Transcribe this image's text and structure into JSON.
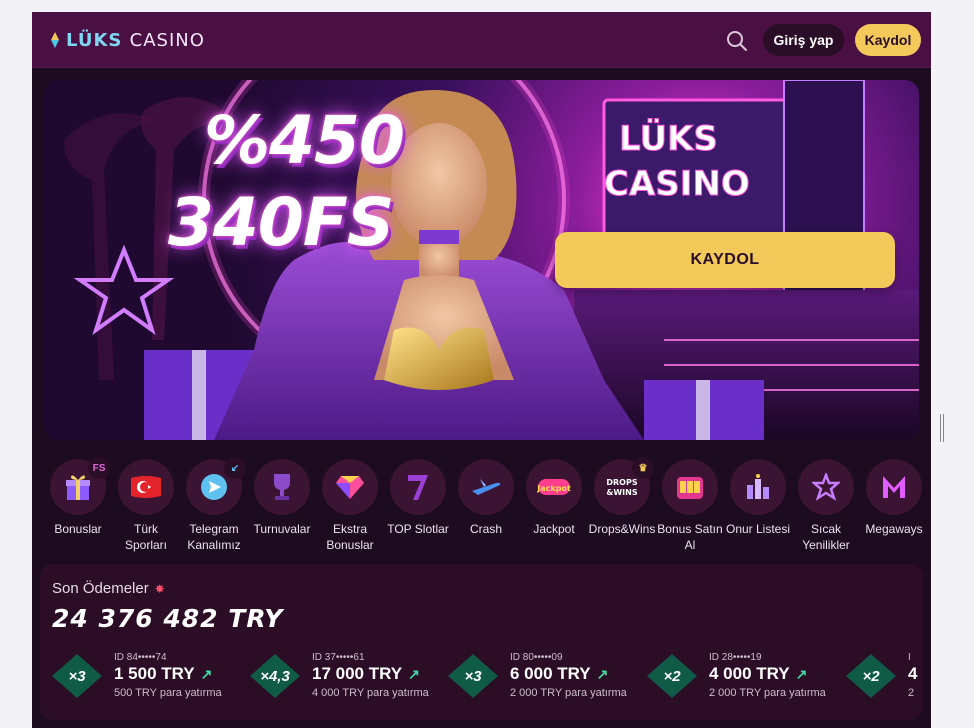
{
  "header": {
    "logo_part1": "LÜKS",
    "logo_part2": "CASINO",
    "login_label": "Giriş yap",
    "register_label": "Kaydol"
  },
  "hero": {
    "promo_line1": "%450",
    "promo_line2": "340FS",
    "cta_label": "KAYDOL",
    "sign_text_1": "LÜKS",
    "sign_text_2": "CASINO"
  },
  "categories": [
    {
      "label": "Bonuslar",
      "icon": "gift-icon",
      "badge": "FS"
    },
    {
      "label": "Türk Sporları",
      "icon": "turkish-flag-icon"
    },
    {
      "label": "Telegram Kanalımız",
      "icon": "telegram-icon",
      "badge": "arrow"
    },
    {
      "label": "Turnuvalar",
      "icon": "trophy-icon"
    },
    {
      "label": "Ekstra Bonuslar",
      "icon": "diamond-icon"
    },
    {
      "label": "TOP Slotlar",
      "icon": "lucky-seven-icon"
    },
    {
      "label": "Crash",
      "icon": "airplane-icon"
    },
    {
      "label": "Jackpot",
      "icon": "jackpot-icon"
    },
    {
      "label": "Drops&Wins",
      "icon": "drops-wins-icon",
      "badge": "crown"
    },
    {
      "label": "Bonus Satın Al",
      "icon": "slot-machine-icon"
    },
    {
      "label": "Onur Listesi",
      "icon": "leaderboard-icon"
    },
    {
      "label": "Sıcak Yenilikler",
      "icon": "star-icon"
    },
    {
      "label": "Megaways",
      "icon": "megaways-icon"
    }
  ],
  "payments": {
    "title": "Son Ödemeler",
    "total": "24 376 482 TRY",
    "items": [
      {
        "multiplier": "×3",
        "id": "ID 84•••••74",
        "amount": "1 500 TRY",
        "sub": "500 TRY para yatırma"
      },
      {
        "multiplier": "×4,3",
        "id": "ID 37•••••61",
        "amount": "17 000 TRY",
        "sub": "4 000 TRY para yatırma"
      },
      {
        "multiplier": "×3",
        "id": "ID 80•••••09",
        "amount": "6 000 TRY",
        "sub": "2 000 TRY para yatırma"
      },
      {
        "multiplier": "×2",
        "id": "ID 28•••••19",
        "amount": "4 000 TRY",
        "sub": "2 000 TRY para yatırma"
      },
      {
        "multiplier": "×2",
        "id": "I",
        "amount": "4",
        "sub": "2"
      }
    ]
  },
  "colors": {
    "header_bg": "#4a0f43",
    "page_bg": "#1d0b1f",
    "accent_yellow": "#f3c95a",
    "panel_bg": "#2b0d26",
    "multiplier_green": "#0f5b46"
  }
}
